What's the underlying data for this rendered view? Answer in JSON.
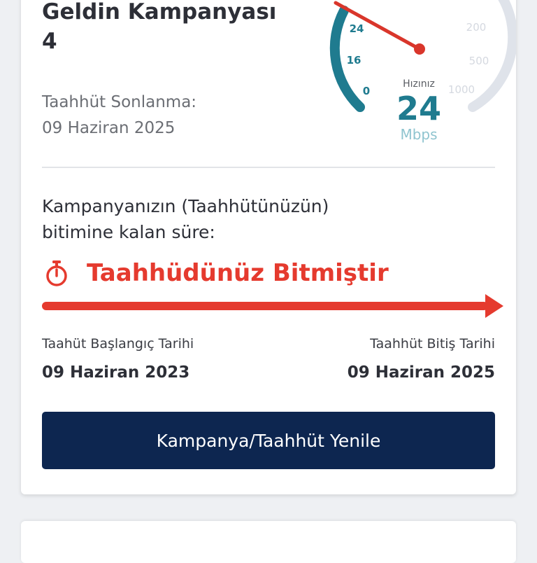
{
  "campaign": {
    "title": "Geldin Kampanyası 4",
    "commitment_end_label": "Taahhüt Sonlanma:",
    "commitment_end_date": "09 Haziran 2025"
  },
  "speed_gauge": {
    "label": "Hızınız",
    "value": "24",
    "unit": "Mbps",
    "left_ticks": [
      "0",
      "16",
      "24"
    ],
    "right_ticks": [
      "200",
      "500",
      "1000"
    ],
    "needle_value": 24,
    "colors": {
      "active_arc": "#1f7b8f",
      "inactive_arc": "#dfe3ea",
      "needle": "#d9362b"
    }
  },
  "remaining": {
    "text": "Kampanyanızın (Taahhütünüzün) bitimine kalan süre:",
    "status": "Taahhüdünüz Bitmiştir",
    "icon": "stopwatch-icon",
    "status_color": "#e53a2e"
  },
  "dates": {
    "start_label": "Taahüt Başlangıç Tarihi",
    "start_value": "09 Haziran 2023",
    "end_label": "Taahhüt Bitiş Tarihi",
    "end_value": "09 Haziran 2025"
  },
  "actions": {
    "renew_label": "Kampanya/Taahhüt Yenile",
    "renew_color": "#0d2650"
  }
}
